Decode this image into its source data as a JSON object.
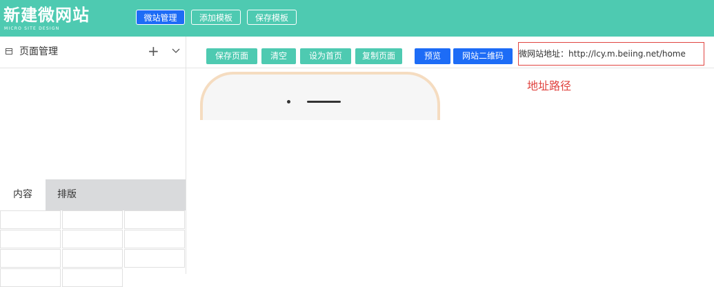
{
  "header": {
    "title": "新建微网站",
    "subtitle": "MICRO SITE DESIGN",
    "buttons": [
      {
        "label": "微站管理",
        "active": true
      },
      {
        "label": "添加模板",
        "active": false
      },
      {
        "label": "保存模板",
        "active": false
      }
    ]
  },
  "sidebar": {
    "title": "页面管理",
    "icons": {
      "page": "page-icon",
      "add": "plus-icon",
      "expand": "chevron-down-icon"
    },
    "tabs": [
      {
        "label": "内容",
        "active": true
      },
      {
        "label": "排版",
        "active": false
      }
    ]
  },
  "toolbar": {
    "buttons": [
      {
        "label": "保存页面",
        "color": "green"
      },
      {
        "label": "清空",
        "color": "green"
      },
      {
        "label": "设为首页",
        "color": "green"
      },
      {
        "label": "复制页面",
        "color": "green"
      },
      {
        "label": "预览",
        "color": "blue"
      },
      {
        "label": "网站二维码",
        "color": "blue"
      }
    ]
  },
  "url": {
    "label": "微网站地址：",
    "value": "http://lcy.m.beiing.net/home"
  },
  "annotation": "地址路径",
  "colors": {
    "brand": "#4ecab1",
    "accent_blue": "#1d6cf6",
    "highlight_red": "#e0433f",
    "phone_frame": "#f5dcc0"
  }
}
